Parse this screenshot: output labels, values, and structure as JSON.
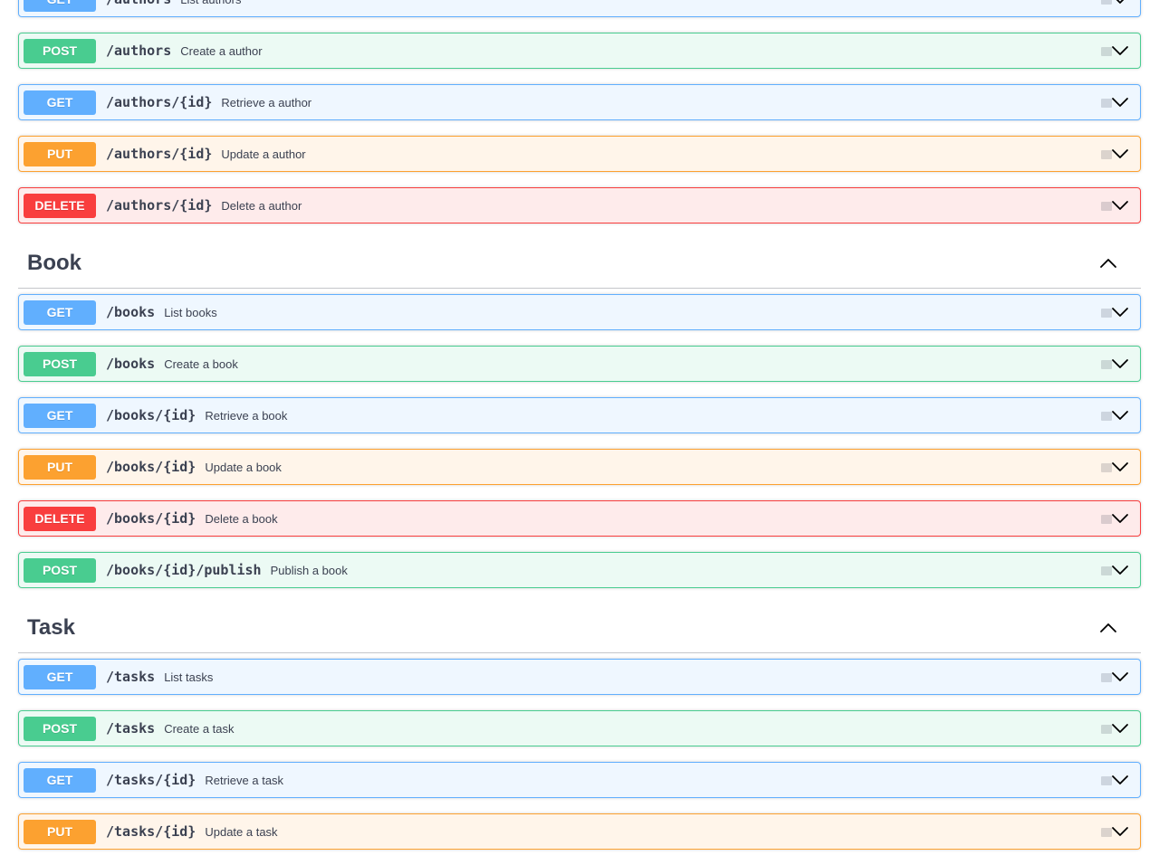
{
  "sections": [
    {
      "key": "author",
      "title": "",
      "show_header": false,
      "operations": [
        {
          "method": "GET",
          "path": "/authors",
          "summary": "List authors"
        },
        {
          "method": "POST",
          "path": "/authors",
          "summary": "Create a author"
        },
        {
          "method": "GET",
          "path": "/authors/{id}",
          "summary": "Retrieve a author"
        },
        {
          "method": "PUT",
          "path": "/authors/{id}",
          "summary": "Update a author"
        },
        {
          "method": "DELETE",
          "path": "/authors/{id}",
          "summary": "Delete a author"
        }
      ]
    },
    {
      "key": "book",
      "title": "Book",
      "show_header": true,
      "operations": [
        {
          "method": "GET",
          "path": "/books",
          "summary": "List books"
        },
        {
          "method": "POST",
          "path": "/books",
          "summary": "Create a book"
        },
        {
          "method": "GET",
          "path": "/books/{id}",
          "summary": "Retrieve a book"
        },
        {
          "method": "PUT",
          "path": "/books/{id}",
          "summary": "Update a book"
        },
        {
          "method": "DELETE",
          "path": "/books/{id}",
          "summary": "Delete a book"
        },
        {
          "method": "POST",
          "path": "/books/{id}/publish",
          "summary": "Publish a book"
        }
      ]
    },
    {
      "key": "task",
      "title": "Task",
      "show_header": true,
      "operations": [
        {
          "method": "GET",
          "path": "/tasks",
          "summary": "List tasks"
        },
        {
          "method": "POST",
          "path": "/tasks",
          "summary": "Create a task"
        },
        {
          "method": "GET",
          "path": "/tasks/{id}",
          "summary": "Retrieve a task"
        },
        {
          "method": "PUT",
          "path": "/tasks/{id}",
          "summary": "Update a task"
        }
      ]
    }
  ],
  "colors": {
    "get": "#61affe",
    "post": "#49cc90",
    "put": "#fca130",
    "delete": "#f93e3e",
    "text": "#3b4151"
  },
  "icons": {
    "expand": "chevron-down-icon",
    "collapse": "chevron-up-icon",
    "lock": "lock-icon"
  }
}
